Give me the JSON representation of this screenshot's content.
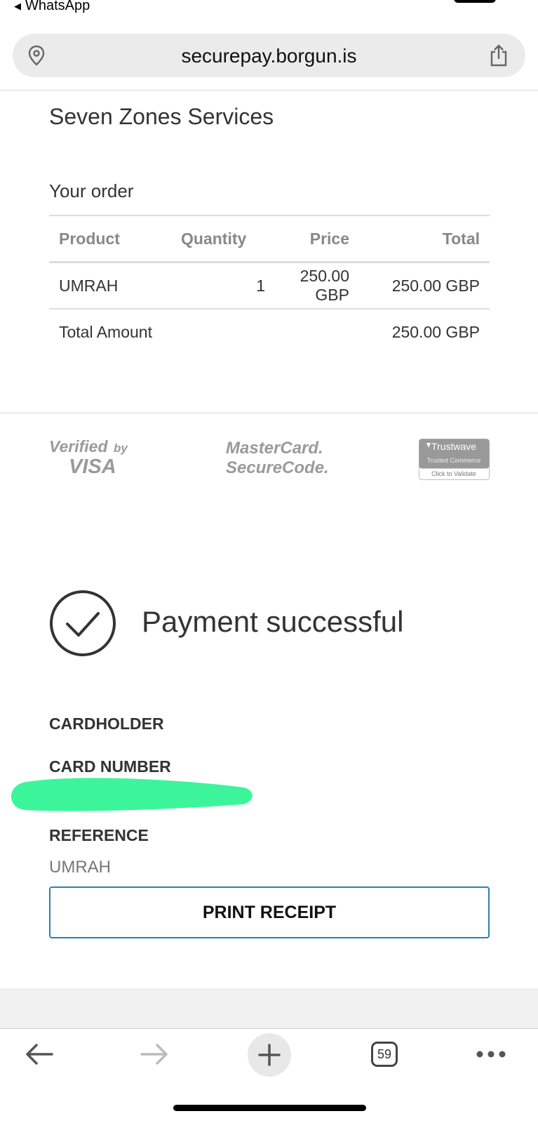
{
  "status_bar": {
    "back_app_label": "WhatsApp"
  },
  "browser": {
    "url": "securepay.borgun.is"
  },
  "merchant": {
    "name": "Seven Zones Services"
  },
  "order": {
    "title": "Your order",
    "columns": [
      "Product",
      "Quantity",
      "Price",
      "Total"
    ],
    "rows": [
      {
        "product": "UMRAH",
        "quantity": "1",
        "price": "250.00 GBP",
        "total": "250.00 GBP"
      }
    ],
    "total_label": "Total Amount",
    "total_value": "250.00 GBP"
  },
  "security_badges": {
    "visa": {
      "line1": "Verified",
      "by": "by",
      "line2": "VISA"
    },
    "mastercard": {
      "line1": "MasterCard.",
      "line2": "SecureCode."
    },
    "trustwave": {
      "name": "Trustwave",
      "subtitle": "Trusted Commerce",
      "cta": "Click to Validate"
    }
  },
  "payment": {
    "status": "Payment successful",
    "cardholder_label": "CARDHOLDER",
    "card_number_label": "CARD NUMBER",
    "reference_label": "REFERENCE",
    "reference_value": "UMRAH",
    "print_button": "PRINT RECEIPT",
    "redaction_color": "#3cf59b"
  },
  "toolbar": {
    "tab_count": "59",
    "icons": [
      "back-arrow-icon",
      "forward-arrow-icon",
      "plus-icon",
      "tabs-icon",
      "more-icon"
    ]
  },
  "colors": {
    "accent_border": "#2d7fb4",
    "text": "#333333",
    "muted": "#888888"
  }
}
